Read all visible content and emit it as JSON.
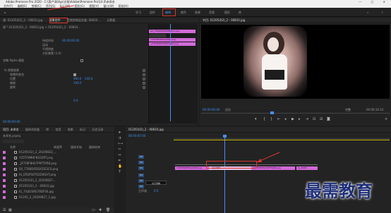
{
  "window": {
    "title": "Adobe Premiere Pro 2020 - C:\\用户\\Ebfyp\\文档\\Adobe\\Premiere Pro\\14.0\\未命名",
    "controls": "— □ ✕"
  },
  "menu": [
    "文件(F)",
    "编辑(E)",
    "剪辑(C)",
    "序列(S)",
    "标记(M)",
    "图形(G)",
    "视图(V)",
    "窗口(W)",
    "帮助(H)"
  ],
  "workspaces": [
    "学习",
    "组件",
    "编辑",
    "颜色",
    "效果",
    "音频",
    "图形",
    "库"
  ],
  "active_workspace": "编辑",
  "source_panel": {
    "tabs": [
      "源: 01205(02)_2 - 00810.jpg",
      "效果控件",
      "音频剪辑混合器: 00810...",
      "元数据"
    ],
    "active_tab": "效果控件",
    "breadcrumb": "源 * 01205(02)_2 - 00810.jpg > 01205(02)_2 - 00810...",
    "rows": {
      "time_label": "持续时间",
      "time_value": "00:00:00:00",
      "motion": "运动",
      "opacity": "不透明度",
      "ratio": "图像长宽比",
      "ratio_value": "方形像素 (1.0)",
      "alpha": "忽略 Alpha 通道",
      "fx_header": "fx 视频效果",
      "fx_item1": "效果的变化",
      "fx_item2": "位置",
      "fx_item3": "缩放",
      "fx_item4": "旋转",
      "v1": "960.0",
      "v2": "540.0",
      "v3": "100.0",
      "v4": "0.0"
    },
    "clips": [
      "00_7780D05E0CEE3C0.png",
      "Y25TF8MHFKGS5RT.png",
      "_JX7F8F8HS7PRFTKR8.png"
    ],
    "timecode": "00:00:00:00"
  },
  "program_monitor": {
    "title": "节目: 01205(02)_2 - 00810.jpg",
    "timecode": "00:00:00:00",
    "fit": "适合",
    "quality": "完整",
    "duration": "00:00:10:10"
  },
  "project_panel": {
    "tabs": [
      "项目: 未命名",
      "媒体浏览器",
      "库",
      "信息",
      "效果",
      "标记",
      "历史记录"
    ],
    "active_tab": "项目: 未命名",
    "project_file": "未命名.prproj",
    "columns": [
      "名称",
      "帧速率",
      "媒体开始",
      "媒体结束"
    ],
    "items": [
      "01205(02)_2_20200822_...",
      "Y25TF8MHFKGS5RT.png",
      "_JX7F8F8HS7PRFTKR8.png",
      "00_7780D05E0CEE3C0.png",
      "IG_ERDFS0TS2D0GHT.png",
      "01205(02)_2_20200827...",
      "01205(02)_2 - 00810.jpg",
      "IG_7XJ42SRE7BDFS6.jpg",
      "01205_2_20200827_1.jpg"
    ]
  },
  "timeline": {
    "tab": "01205(02)_2 - 00810.jpg",
    "timecode": "00:00:05:00",
    "tracks": [
      "V3",
      "V2",
      "V1",
      "A1",
      "A2",
      "A3"
    ],
    "master": "主声道",
    "master_value": "0.0",
    "clips": [
      {
        "label": "Y25TF8MHFKGS5RT.png"
      },
      {
        "label": "交叉溶解"
      },
      {
        "label": "_JX7F8F8HS7PRFTKR8.png"
      },
      {
        "label": "IG_ERDF..."
      }
    ],
    "tooltip": "交叉溶解"
  },
  "watermark": "最需教育",
  "colors": {
    "accent": "#4a8ef0",
    "clip": "#d26ad8",
    "annotation": "#d9362d"
  }
}
